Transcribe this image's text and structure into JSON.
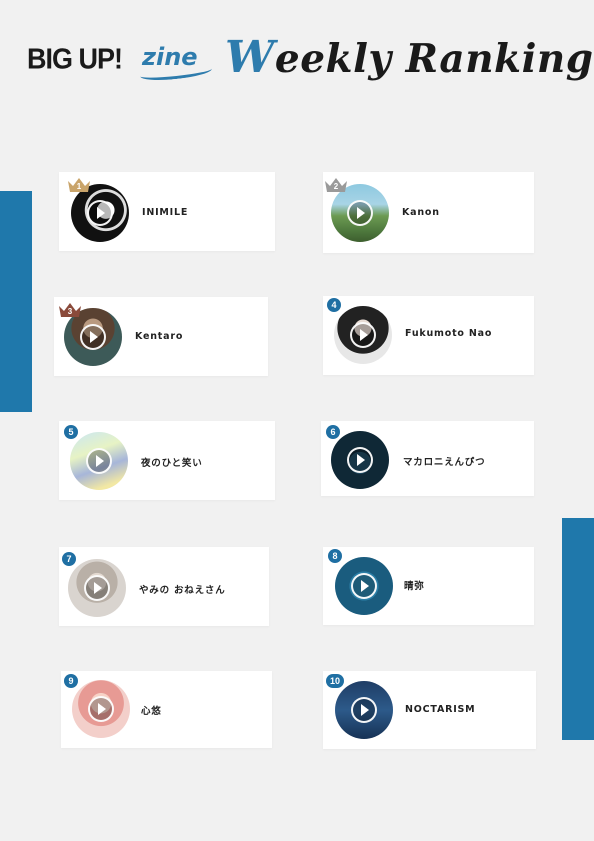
{
  "header": {
    "brand": "BIG UP!",
    "brand_suffix": "zine",
    "title_initial": "W",
    "title_rest": "eekly Ranking"
  },
  "colors": {
    "accent": "#2e7cad",
    "side_bar": "#1f78ab",
    "badge": "#1f6fa3",
    "gold": "#c9a46a",
    "silver": "#9a9a9a",
    "bronze": "#8a4a3a"
  },
  "rankings": [
    {
      "rank": "1",
      "name": "INIMILE",
      "crown": "gold-crown-icon"
    },
    {
      "rank": "2",
      "name": "Kanon",
      "crown": "silver-crown-icon"
    },
    {
      "rank": "3",
      "name": "Kentaro",
      "crown": "bronze-crown-icon"
    },
    {
      "rank": "4",
      "name": "Fukumoto Nao"
    },
    {
      "rank": "5",
      "name": "夜のひと笑い"
    },
    {
      "rank": "6",
      "name": "マカロニえんぴつ"
    },
    {
      "rank": "7",
      "name": "やみの おねえさん"
    },
    {
      "rank": "8",
      "name": "晴弥"
    },
    {
      "rank": "9",
      "name": "心悠"
    },
    {
      "rank": "10",
      "name": "NOCTARISM"
    }
  ]
}
